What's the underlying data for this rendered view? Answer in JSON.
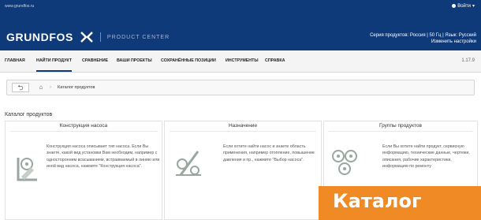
{
  "header": {
    "top_link": "www.grundfos.ru",
    "login": "Войти",
    "logo": "GRUNDFOS",
    "product_center": "PRODUCT CENTER",
    "region_line1": "Серия продуктов: Россия | 50 Гц | Язык: Русский",
    "region_line2": "Изменить настройки"
  },
  "nav": {
    "items": [
      "ГЛАВНАЯ",
      "НАЙТИ ПРОДУКТ",
      "СРАВНЕНИЕ",
      "ВАШИ ПРОЕКТЫ",
      "СОХРАНЁННЫЕ ПОЗИЦИИ",
      "ИНСТРУМЕНТЫ",
      "СПРАВКА"
    ],
    "active": "НАЙТИ ПРОДУКТ",
    "version": "1.17.9"
  },
  "breadcrumb": {
    "back": "⮌",
    "home": "⌂",
    "separator": "›",
    "current": "Каталог продуктов"
  },
  "section_title": "Каталог продуктов",
  "cards": [
    {
      "title": "Конструкция насоса",
      "icon": "pump-design-icon",
      "text": "Конструкция насоса описывает тип насоса. Если Вы знаете, какой вид установки Вам необходим, например с односторонним всасыванием, встраиваемый в линию или иной вид насоса, нажмите \"Конструкция насоса\"."
    },
    {
      "title": "Назначение",
      "icon": "application-icon",
      "text": "Если хотите найти насос и знаете область применения, например отопление, повышение давления и пр., нажмите \"Выбор насоса\"."
    },
    {
      "title": "Группы продуктов",
      "icon": "product-groups-icon",
      "text": "Если Вы хотите найти продукт, сервисную информацию, технические данные, чертежи, описания, рабочие характеристики, информацию по ремонту"
    }
  ],
  "overlay_label": "Каталог",
  "colors": {
    "header_bg": "#0f3a7a",
    "accent": "#f08a24"
  }
}
